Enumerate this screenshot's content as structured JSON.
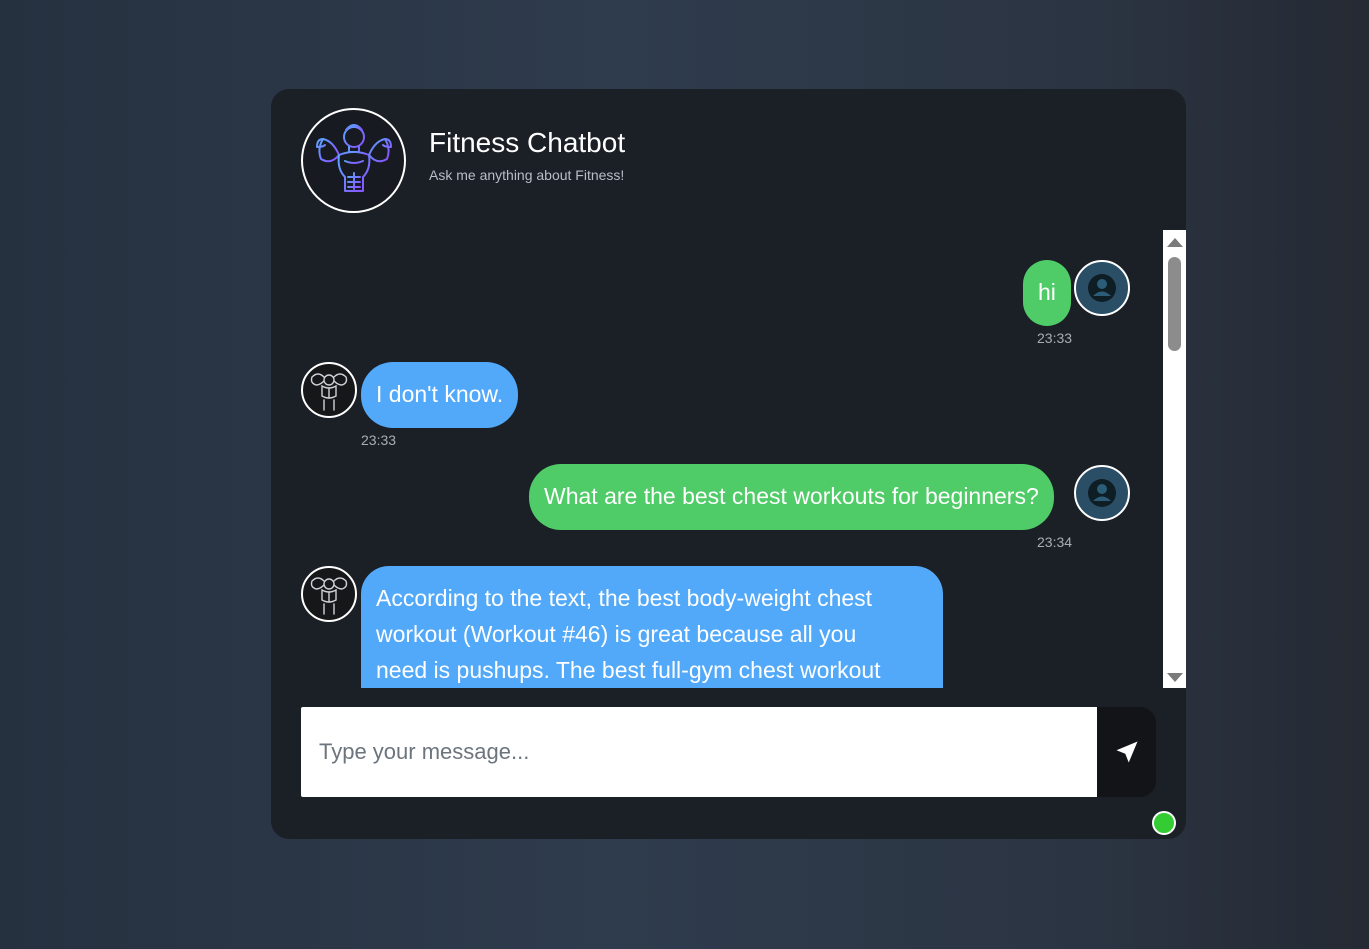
{
  "header": {
    "title": "Fitness Chatbot",
    "subtitle": "Ask me anything about Fitness!",
    "logo_icon": "muscle-man-icon"
  },
  "messages": [
    {
      "sender": "user",
      "text": "hi",
      "time": "23:33"
    },
    {
      "sender": "bot",
      "text": "I don't know.",
      "time": "23:33"
    },
    {
      "sender": "user",
      "text": "What are the best chest workouts for beginners?",
      "time": "23:34"
    },
    {
      "sender": "bot",
      "lines": [
        "According to the text, the best body-weight chest",
        "workout (Workout #46) is great because all you",
        "need is pushups. The best full-gym chest workout"
      ]
    }
  ],
  "composer": {
    "placeholder": "Type your message...",
    "send_icon": "send-arrow-icon"
  },
  "status": {
    "color": "#33cc33"
  },
  "colors": {
    "user_bubble": "#4fcb67",
    "bot_bubble": "#52a9f9",
    "card_background": "#1b1f26"
  }
}
